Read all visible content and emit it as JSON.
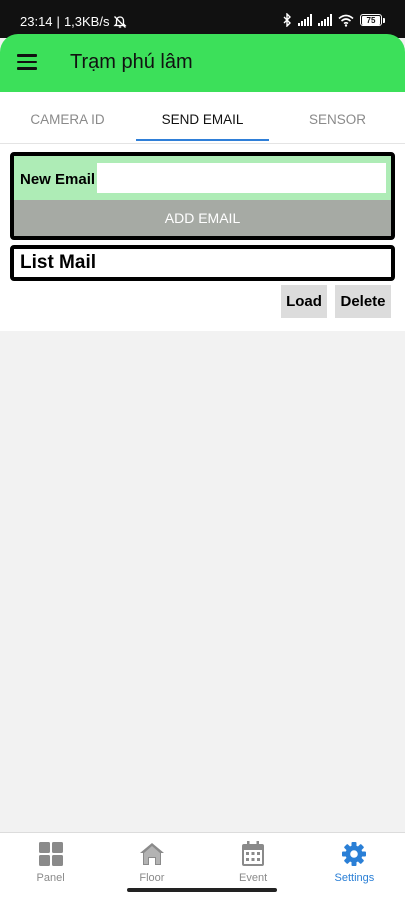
{
  "status": {
    "time": "23:14",
    "speed": "1,3KB/s",
    "battery": "75"
  },
  "app": {
    "title": "Trạm phú lâm",
    "accent": "#3ce05a"
  },
  "tabs": [
    {
      "label": "CAMERA ID",
      "active": false
    },
    {
      "label": "SEND EMAIL",
      "active": true
    },
    {
      "label": "SENSOR",
      "active": false
    }
  ],
  "email_form": {
    "label": "New Email",
    "value": "",
    "placeholder": "",
    "add_label": "ADD EMAIL"
  },
  "list": {
    "title": "List Mail",
    "load_label": "Load",
    "delete_label": "Delete"
  },
  "nav": [
    {
      "label": "Panel",
      "icon": "grid-icon",
      "active": false
    },
    {
      "label": "Floor",
      "icon": "home-icon",
      "active": false
    },
    {
      "label": "Event",
      "icon": "calendar-icon",
      "active": false
    },
    {
      "label": "Settings",
      "icon": "gear-icon",
      "active": true
    }
  ]
}
